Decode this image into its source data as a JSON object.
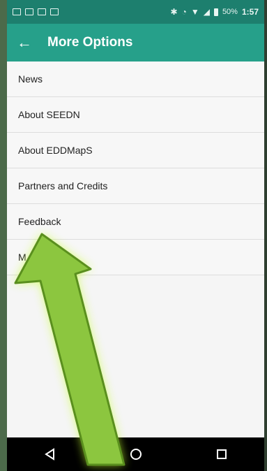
{
  "status_bar": {
    "left_icons": [
      "image-icon",
      "mail-icon",
      "mail-icon",
      "briefcase-icon"
    ],
    "right_icons": [
      "bluetooth-icon",
      "alarm-icon",
      "wifi-icon",
      "signal-icon",
      "battery-icon"
    ],
    "battery": "50%",
    "time": "1:57"
  },
  "app_bar": {
    "title": "More Options",
    "back_icon": "back-arrow-icon"
  },
  "menu": {
    "items": [
      {
        "label": "News"
      },
      {
        "label": "About SEEDN"
      },
      {
        "label": "About EDDMapS"
      },
      {
        "label": "Partners and Credits"
      },
      {
        "label": "Feedback"
      },
      {
        "label": "M...ood apps"
      }
    ]
  },
  "nav_bar": {
    "buttons": [
      "back-triangle-icon",
      "home-circle-icon",
      "recents-square-icon"
    ]
  },
  "annotation": {
    "color": "#8cc63f",
    "glow": "#c6ff2d",
    "target": "Feedback"
  }
}
